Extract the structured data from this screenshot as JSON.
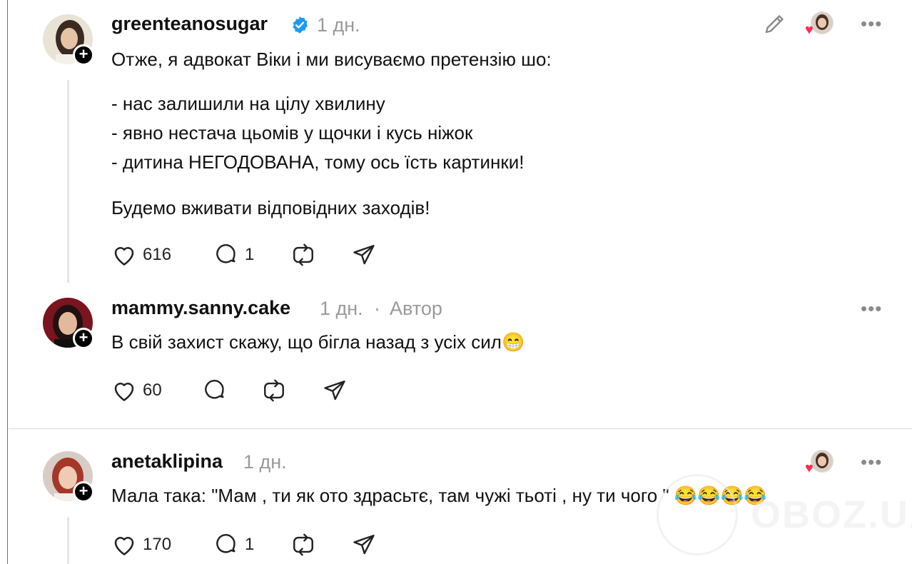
{
  "posts": [
    {
      "username": "greenteanosugar",
      "time": "1 дн.",
      "verified": true,
      "text_lines": [
        "Отже, я адвокат Віки і ми висуваємо претензію шо:",
        "",
        "- нас залишили на цілу хвилину",
        "- явно нестача цьомів у щочки і кусь ніжок",
        "- дитина НЕГОДОВАНА, тому ось їсть картинки!",
        "",
        "Будемо вживати відповідних заходів!"
      ],
      "likes": "616",
      "replies": "1"
    },
    {
      "username": "mammy.sanny.cake",
      "time": "1 дн.",
      "separator": "·",
      "author_label": "Автор",
      "text": "В свій захист скажу, що бігла назад з усіх сил😁",
      "likes": "60",
      "replies": ""
    },
    {
      "username": "anetaklipina",
      "time": "1 дн.",
      "text": "Мала така: \"Мам , ти як ото здрасьтє, там чужі тьоті , ну ти чого \" 😂😂😂😂",
      "likes": "170",
      "replies": "1"
    }
  ],
  "icons": {
    "like": "heart-icon",
    "reply": "comment-icon",
    "repost": "repost-icon",
    "share": "share-icon",
    "edit": "pencil-icon",
    "more": "more-icon",
    "verified": "verified-badge-icon"
  },
  "more_glyph": "•••",
  "follow_glyph": "+",
  "heart_glyph": "♥",
  "watermark": "OBOZ.UA",
  "colors": {
    "verified": "#1d9bf0",
    "heart": "#ff2d55",
    "meta": "#9a9a9a"
  }
}
